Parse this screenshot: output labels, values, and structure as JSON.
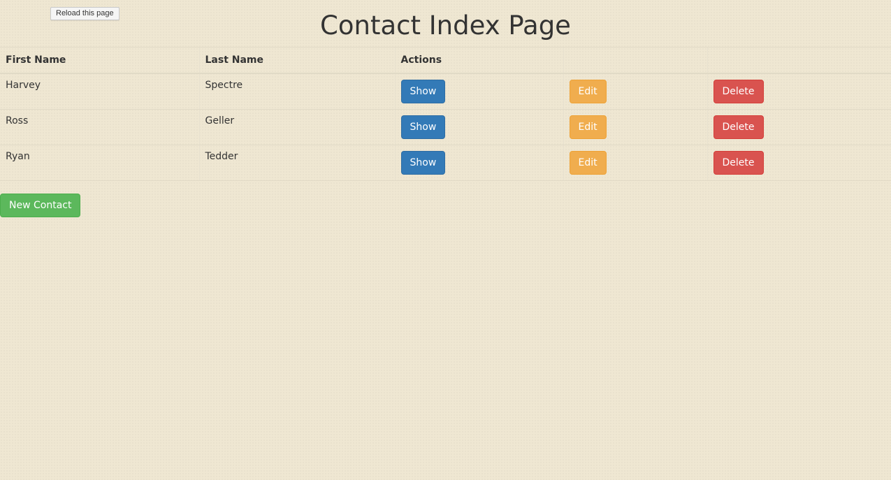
{
  "tooltip": {
    "text": "Reload this page"
  },
  "page": {
    "title": "Contact Index Page"
  },
  "table": {
    "headers": {
      "first_name": "First Name",
      "last_name": "Last Name",
      "actions": "Actions"
    },
    "rows": [
      {
        "first_name": "Harvey",
        "last_name": "Spectre",
        "show": "Show",
        "edit": "Edit",
        "delete": "Delete"
      },
      {
        "first_name": "Ross",
        "last_name": "Geller",
        "show": "Show",
        "edit": "Edit",
        "delete": "Delete"
      },
      {
        "first_name": "Ryan",
        "last_name": "Tedder",
        "show": "Show",
        "edit": "Edit",
        "delete": "Delete"
      }
    ]
  },
  "actions": {
    "new_contact_label": "New Contact"
  },
  "colors": {
    "background": "#efe7d2",
    "primary": "#337ab7",
    "warning": "#f0ad4e",
    "danger": "#d9534f",
    "success": "#5cb85c"
  }
}
